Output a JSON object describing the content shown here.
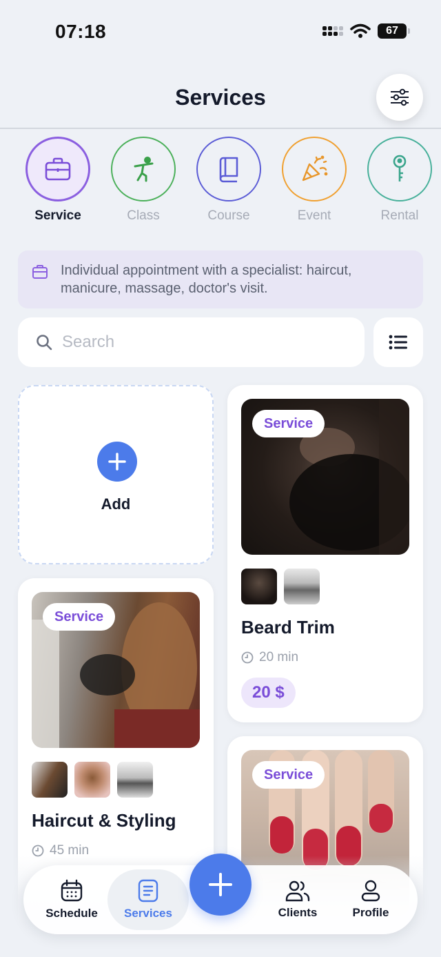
{
  "status_bar": {
    "time": "07:18",
    "battery": "67"
  },
  "header": {
    "title": "Services"
  },
  "types": [
    {
      "label": "Service",
      "icon": "briefcase-icon",
      "color": "#7a4dd8",
      "active": true
    },
    {
      "label": "Class",
      "icon": "martial-arts-icon",
      "color": "#4bb05a",
      "active": false
    },
    {
      "label": "Course",
      "icon": "book-icon",
      "color": "#5b5cd6",
      "active": false
    },
    {
      "label": "Event",
      "icon": "party-popper-icon",
      "color": "#f0a030",
      "active": false
    },
    {
      "label": "Rental",
      "icon": "key-icon",
      "color": "#47b09a",
      "active": false
    }
  ],
  "info": {
    "text": "Individual appointment with a specialist: haircut, manicure, massage, doctor's visit."
  },
  "search": {
    "placeholder": "Search"
  },
  "add_card": {
    "label": "Add"
  },
  "cards": [
    {
      "badge": "Service",
      "title": "Beard Trim",
      "duration": "20 min",
      "price": "20 $"
    },
    {
      "badge": "Service",
      "title": "Haircut & Styling",
      "duration": "45 min"
    },
    {
      "badge": "Service"
    }
  ],
  "tab_bar": {
    "schedule": "Schedule",
    "services": "Services",
    "clients": "Clients",
    "profile": "Profile"
  },
  "colors": {
    "accent": "#4c7bea",
    "brand_purple": "#7a4dd8",
    "background": "#eef1f6"
  }
}
